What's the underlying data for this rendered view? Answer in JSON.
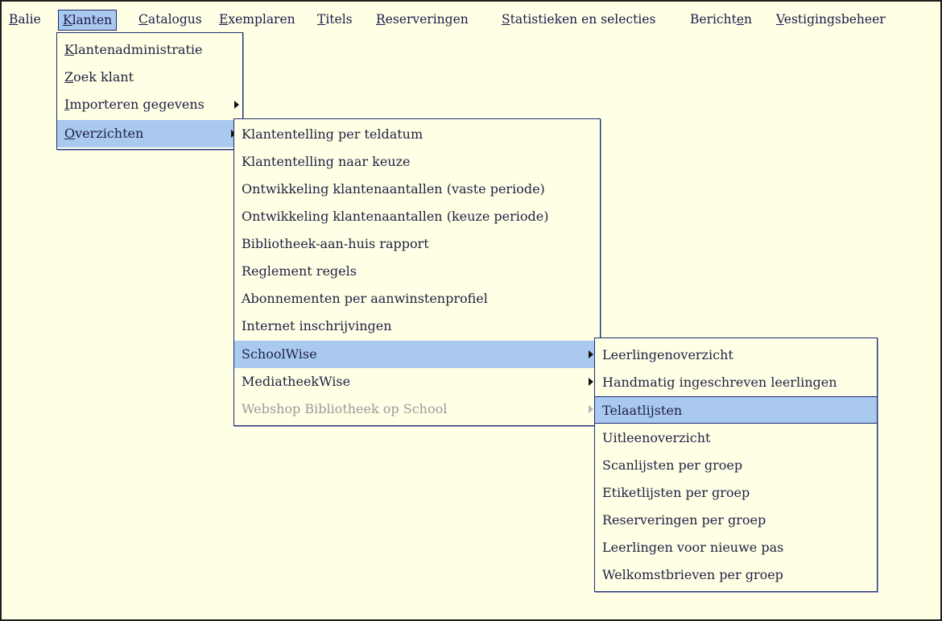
{
  "menubar": {
    "items": [
      {
        "pre": "",
        "u": "B",
        "post": "alie"
      },
      {
        "pre": "",
        "u": "K",
        "post": "lanten"
      },
      {
        "pre": "",
        "u": "C",
        "post": "atalogus"
      },
      {
        "pre": "",
        "u": "E",
        "post": "xemplaren"
      },
      {
        "pre": "",
        "u": "T",
        "post": "itels"
      },
      {
        "pre": "",
        "u": "R",
        "post": "eserveringen"
      },
      {
        "pre": "",
        "u": "S",
        "post": "tatistieken en selecties"
      },
      {
        "pre": "Bericht",
        "u": "e",
        "post": "n"
      },
      {
        "pre": "",
        "u": "V",
        "post": "estigingsbeheer"
      }
    ]
  },
  "klanten_menu": {
    "items": [
      {
        "pre": "",
        "u": "K",
        "post": "lantenadministratie"
      },
      {
        "pre": "",
        "u": "Z",
        "post": "oek klant"
      },
      {
        "pre": "",
        "u": "I",
        "post": "mporteren gegevens"
      },
      {
        "pre": "",
        "u": "O",
        "post": "verzichten"
      }
    ]
  },
  "overzichten_menu": {
    "items": [
      "Klantentelling per teldatum",
      "Klantentelling naar keuze",
      "Ontwikkeling klantenaantallen (vaste periode)",
      "Ontwikkeling klantenaantallen (keuze periode)",
      "Bibliotheek-aan-huis rapport",
      "Reglement regels",
      "Abonnementen per aanwinstenprofiel",
      "Internet inschrijvingen",
      "SchoolWise",
      "MediatheekWise",
      "Webshop Bibliotheek op School"
    ]
  },
  "schoolwise_menu": {
    "items": [
      "Leerlingenoverzicht",
      "Handmatig ingeschreven leerlingen",
      "Telaatlijsten",
      "Uitleenoverzicht",
      "Scanlijsten per groep",
      "Etiketlijsten per groep",
      "Reserveringen per groep",
      "Leerlingen voor nieuwe pas",
      "Welkomstbrieven per groep"
    ]
  },
  "colors": {
    "background": "#ffffe6",
    "highlight": "#a9c9ef",
    "border": "#1d2c73",
    "disabled_text": "#9a9a9a"
  }
}
